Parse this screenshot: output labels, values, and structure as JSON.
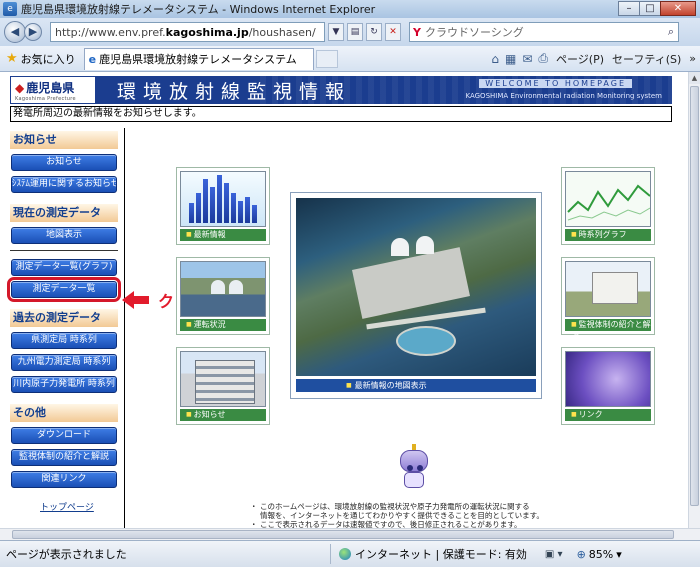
{
  "browser": {
    "window_title": "鹿児島県環境放射線テレメータシステム - Windows Internet Explorer",
    "url_prefix": "http://www.env.pref.",
    "url_domain": "kagoshima.jp",
    "url_path": "/houshasen/",
    "search_placeholder": "クラウドソーシング",
    "favorites_label": "お気に入り",
    "tab_title": "鹿児島県環境放射線テレメータシステム",
    "page_menu": "ページ(P)",
    "safety_menu": "セーフティ(S)",
    "more_chevron": "»"
  },
  "site": {
    "logo_text": "鹿児島県",
    "logo_sub": "Kagoshima Prefecture",
    "banner_title": "環境放射線監視情報",
    "welcome": "WELCOME TO HOMEPAGE",
    "banner_en": "KAGOSHIMA Environmental radiation Monitoring system",
    "notice": "発電所周辺の最新情報をお知らせします。"
  },
  "leftnav": {
    "sec_news": "お知らせ",
    "btn_news": "お知らせ",
    "btn_system": "ｼｽﾃﾑ運用に関するお知らせ",
    "sec_current": "現在の測定データ",
    "btn_map": "地図表示",
    "btn_list_graph": "測定データ一覧(グラフ)",
    "btn_list": "測定データ一覧",
    "sec_past": "過去の測定データ",
    "btn_pref_ts": "県測定局 時系列",
    "btn_kyuden_ts": "九州電力測定局 時系列",
    "btn_sendai_ts": "川内原子力発電所 時系列",
    "sec_other": "その他",
    "btn_download": "ダウンロード",
    "btn_monitor": "監視体制の紹介と解説",
    "btn_links": "関連リンク",
    "top_link": "トップページ"
  },
  "annotation": {
    "text": "クリック",
    "color": "#e21b2c"
  },
  "tiles": {
    "latest": "最新情報",
    "operation": "運転状況",
    "news": "お知らせ",
    "map_latest": "最新情報の地図表示",
    "timeseries": "時系列グラフ",
    "monitoring": "監視体制の紹介と解説",
    "link": "リンク"
  },
  "notes": {
    "bullet": "・",
    "line1a": "このホームページは、環境放射線の監視状況や原子力発電所の運転状況に関する",
    "line1b": "情報を、インターネットを通じてわかりやすく提供できることを目的としています。",
    "line2": "ここで表示されるデータは速報値ですので、後日修正されることがあります。"
  },
  "status": {
    "text": "ページが表示されました",
    "zone": "インターネット | 保護モード: 有効",
    "zoom": "85%"
  },
  "colors": {
    "nav_button": "#1a4fb5",
    "banner": "#1b3d8f",
    "tile_caption": "#3a8b43",
    "highlight_box": "#d4182a"
  }
}
